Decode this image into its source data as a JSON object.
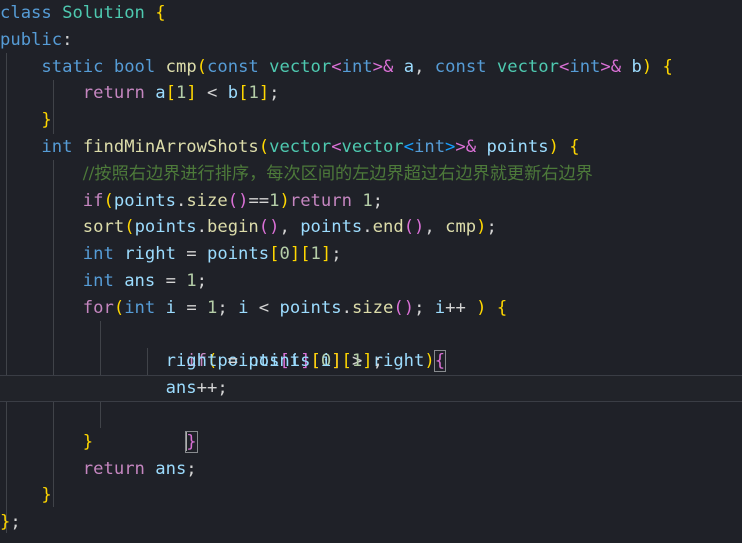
{
  "editor": {
    "language": "cpp",
    "theme": "dark-plus",
    "background": "#1f2128",
    "font_size_px": 17.2,
    "line_height_px": 26.8,
    "tab_size": 4,
    "current_line_number": 14,
    "cursor_line": 15,
    "colors": {
      "keyword": "#569cd6",
      "control": "#c586c0",
      "type": "#4ec9b0",
      "function": "#dcdcaa",
      "variable": "#9cdcfe",
      "number": "#b5cea8",
      "comment": "#4d7a3a",
      "operator": "#d4d4d4",
      "bracket_level_1": "#ffd700",
      "bracket_level_2": "#da70d6",
      "bracket_level_3": "#179fff",
      "indent_guide": "#404349",
      "current_line_border": "#3a3d45",
      "bracket_match_outline": "#888b8f",
      "cursor": "#aeafad"
    }
  },
  "code": {
    "lines": [
      "class Solution {",
      "public:",
      "    static bool cmp(const vector<int>& a, const vector<int>& b) {",
      "        return a[1] < b[1];",
      "    }",
      "    int findMinArrowShots(vector<vector<int>>& points) {",
      "        //按照右边界进行排序，每次区间的左边界超过右边界就更新右边界",
      "        if(points.size()==1)return 1;",
      "        sort(points.begin(), points.end(), cmp);",
      "        int right = points[0][1];",
      "        int ans = 1;",
      "        for(int i = 1; i < points.size(); i++ ) {",
      "            if(points[i][0] > right){",
      "                right = points[i][1];",
      "                ans++;",
      "            }",
      "        }",
      "        return ans;",
      "    }",
      "};"
    ],
    "comment_text": "//按照右边界进行排序，每次区间的左边界超过右边界就更新右边界",
    "class_name": "Solution",
    "methods": [
      "cmp",
      "findMinArrowShots"
    ],
    "variables": [
      "a",
      "b",
      "points",
      "right",
      "ans",
      "i"
    ],
    "literals": [
      "1",
      "0"
    ]
  },
  "tokens": {
    "l1": [
      {
        "t": "class",
        "c": "kw"
      },
      {
        "t": " ",
        "c": "op"
      },
      {
        "t": "Solution",
        "c": "type"
      },
      {
        "t": " ",
        "c": "op"
      },
      {
        "t": "{",
        "c": "b1"
      }
    ],
    "l2": [
      {
        "t": "public",
        "c": "kw"
      },
      {
        "t": ":",
        "c": "op"
      }
    ],
    "l3": [
      {
        "t": "    ",
        "c": "op"
      },
      {
        "t": "static",
        "c": "kw"
      },
      {
        "t": " ",
        "c": "op"
      },
      {
        "t": "bool",
        "c": "kw"
      },
      {
        "t": " ",
        "c": "op"
      },
      {
        "t": "cmp",
        "c": "fn"
      },
      {
        "t": "(",
        "c": "b1"
      },
      {
        "t": "const",
        "c": "kw"
      },
      {
        "t": " ",
        "c": "op"
      },
      {
        "t": "vector",
        "c": "type"
      },
      {
        "t": "<",
        "c": "b2"
      },
      {
        "t": "int",
        "c": "kw"
      },
      {
        "t": ">",
        "c": "b2"
      },
      {
        "t": "&",
        "c": "b2"
      },
      {
        "t": " ",
        "c": "op"
      },
      {
        "t": "a",
        "c": "var"
      },
      {
        "t": ", ",
        "c": "op"
      },
      {
        "t": "const",
        "c": "kw"
      },
      {
        "t": " ",
        "c": "op"
      },
      {
        "t": "vector",
        "c": "type"
      },
      {
        "t": "<",
        "c": "b2"
      },
      {
        "t": "int",
        "c": "kw"
      },
      {
        "t": ">",
        "c": "b2"
      },
      {
        "t": "&",
        "c": "b2"
      },
      {
        "t": " ",
        "c": "op"
      },
      {
        "t": "b",
        "c": "var"
      },
      {
        "t": ")",
        "c": "b1"
      },
      {
        "t": " ",
        "c": "op"
      },
      {
        "t": "{",
        "c": "b1"
      }
    ],
    "l4": [
      {
        "t": "        ",
        "c": "op"
      },
      {
        "t": "return",
        "c": "ctrl"
      },
      {
        "t": " ",
        "c": "op"
      },
      {
        "t": "a",
        "c": "var"
      },
      {
        "t": "[",
        "c": "b1"
      },
      {
        "t": "1",
        "c": "num"
      },
      {
        "t": "]",
        "c": "b1"
      },
      {
        "t": " < ",
        "c": "op"
      },
      {
        "t": "b",
        "c": "var"
      },
      {
        "t": "[",
        "c": "b1"
      },
      {
        "t": "1",
        "c": "num"
      },
      {
        "t": "]",
        "c": "b1"
      },
      {
        "t": ";",
        "c": "op"
      }
    ],
    "l5": [
      {
        "t": "    ",
        "c": "op"
      },
      {
        "t": "}",
        "c": "b1"
      }
    ],
    "l6": [
      {
        "t": "    ",
        "c": "op"
      },
      {
        "t": "int",
        "c": "kw"
      },
      {
        "t": " ",
        "c": "op"
      },
      {
        "t": "findMinArrowShots",
        "c": "fn"
      },
      {
        "t": "(",
        "c": "b1"
      },
      {
        "t": "vector",
        "c": "type"
      },
      {
        "t": "<",
        "c": "b2"
      },
      {
        "t": "vector",
        "c": "type"
      },
      {
        "t": "<",
        "c": "b3"
      },
      {
        "t": "int",
        "c": "kw"
      },
      {
        "t": ">",
        "c": "b3"
      },
      {
        "t": ">",
        "c": "b2"
      },
      {
        "t": "&",
        "c": "b2"
      },
      {
        "t": " ",
        "c": "op"
      },
      {
        "t": "points",
        "c": "var"
      },
      {
        "t": ")",
        "c": "b1"
      },
      {
        "t": " ",
        "c": "op"
      },
      {
        "t": "{",
        "c": "b1"
      }
    ],
    "l7": [
      {
        "t": "        ",
        "c": "op"
      },
      {
        "t": "//按照右边界进行排序，每次区间的左边界超过右边界就更新右边界",
        "c": "cmt"
      }
    ],
    "l8": [
      {
        "t": "        ",
        "c": "op"
      },
      {
        "t": "if",
        "c": "ctrl"
      },
      {
        "t": "(",
        "c": "b1"
      },
      {
        "t": "points",
        "c": "var"
      },
      {
        "t": ".",
        "c": "op"
      },
      {
        "t": "size",
        "c": "fn"
      },
      {
        "t": "(",
        "c": "b2"
      },
      {
        "t": ")",
        "c": "b2"
      },
      {
        "t": "==",
        "c": "op"
      },
      {
        "t": "1",
        "c": "num"
      },
      {
        "t": ")",
        "c": "b1"
      },
      {
        "t": "return",
        "c": "ctrl"
      },
      {
        "t": " ",
        "c": "op"
      },
      {
        "t": "1",
        "c": "num"
      },
      {
        "t": ";",
        "c": "op"
      }
    ],
    "l9": [
      {
        "t": "        ",
        "c": "op"
      },
      {
        "t": "sort",
        "c": "fn"
      },
      {
        "t": "(",
        "c": "b1"
      },
      {
        "t": "points",
        "c": "var"
      },
      {
        "t": ".",
        "c": "op"
      },
      {
        "t": "begin",
        "c": "fn"
      },
      {
        "t": "(",
        "c": "b2"
      },
      {
        "t": ")",
        "c": "b2"
      },
      {
        "t": ", ",
        "c": "op"
      },
      {
        "t": "points",
        "c": "var"
      },
      {
        "t": ".",
        "c": "op"
      },
      {
        "t": "end",
        "c": "fn"
      },
      {
        "t": "(",
        "c": "b2"
      },
      {
        "t": ")",
        "c": "b2"
      },
      {
        "t": ", ",
        "c": "op"
      },
      {
        "t": "cmp",
        "c": "fn"
      },
      {
        "t": ")",
        "c": "b1"
      },
      {
        "t": ";",
        "c": "op"
      }
    ],
    "l10": [
      {
        "t": "        ",
        "c": "op"
      },
      {
        "t": "int",
        "c": "kw"
      },
      {
        "t": " ",
        "c": "op"
      },
      {
        "t": "right",
        "c": "var"
      },
      {
        "t": " = ",
        "c": "op"
      },
      {
        "t": "points",
        "c": "var"
      },
      {
        "t": "[",
        "c": "b1"
      },
      {
        "t": "0",
        "c": "num"
      },
      {
        "t": "]",
        "c": "b1"
      },
      {
        "t": "[",
        "c": "b1"
      },
      {
        "t": "1",
        "c": "num"
      },
      {
        "t": "]",
        "c": "b1"
      },
      {
        "t": ";",
        "c": "op"
      }
    ],
    "l11": [
      {
        "t": "        ",
        "c": "op"
      },
      {
        "t": "int",
        "c": "kw"
      },
      {
        "t": " ",
        "c": "op"
      },
      {
        "t": "ans",
        "c": "var"
      },
      {
        "t": " = ",
        "c": "op"
      },
      {
        "t": "1",
        "c": "num"
      },
      {
        "t": ";",
        "c": "op"
      }
    ],
    "l12": [
      {
        "t": "        ",
        "c": "op"
      },
      {
        "t": "for",
        "c": "ctrl"
      },
      {
        "t": "(",
        "c": "b1"
      },
      {
        "t": "int",
        "c": "kw"
      },
      {
        "t": " ",
        "c": "op"
      },
      {
        "t": "i",
        "c": "var"
      },
      {
        "t": " = ",
        "c": "op"
      },
      {
        "t": "1",
        "c": "num"
      },
      {
        "t": "; ",
        "c": "op"
      },
      {
        "t": "i",
        "c": "var"
      },
      {
        "t": " < ",
        "c": "op"
      },
      {
        "t": "points",
        "c": "var"
      },
      {
        "t": ".",
        "c": "op"
      },
      {
        "t": "size",
        "c": "fn"
      },
      {
        "t": "(",
        "c": "b2"
      },
      {
        "t": ")",
        "c": "b2"
      },
      {
        "t": "; ",
        "c": "op"
      },
      {
        "t": "i",
        "c": "var"
      },
      {
        "t": "++ ",
        "c": "op"
      },
      {
        "t": ")",
        "c": "b1"
      },
      {
        "t": " ",
        "c": "op"
      },
      {
        "t": "{",
        "c": "b1"
      }
    ],
    "l13": [
      {
        "t": "            ",
        "c": "op"
      },
      {
        "t": "if",
        "c": "ctrl"
      },
      {
        "t": "(",
        "c": "b1"
      },
      {
        "t": "points",
        "c": "var"
      },
      {
        "t": "[",
        "c": "b2"
      },
      {
        "t": "i",
        "c": "var"
      },
      {
        "t": "]",
        "c": "b2"
      },
      {
        "t": "[",
        "c": "b2"
      },
      {
        "t": "0",
        "c": "num"
      },
      {
        "t": "]",
        "c": "b2"
      },
      {
        "t": " > ",
        "c": "op"
      },
      {
        "t": "right",
        "c": "var"
      },
      {
        "t": ")",
        "c": "b1"
      }
    ],
    "l13b": "{",
    "l14": [
      {
        "t": "                ",
        "c": "op"
      },
      {
        "t": "right",
        "c": "var"
      },
      {
        "t": " = ",
        "c": "op"
      },
      {
        "t": "points",
        "c": "var"
      },
      {
        "t": "[",
        "c": "b1"
      },
      {
        "t": "i",
        "c": "var"
      },
      {
        "t": "]",
        "c": "b1"
      },
      {
        "t": "[",
        "c": "b1"
      },
      {
        "t": "1",
        "c": "num"
      },
      {
        "t": "]",
        "c": "b1"
      },
      {
        "t": ";",
        "c": "op"
      }
    ],
    "l15": [
      {
        "t": "                ",
        "c": "op"
      },
      {
        "t": "ans",
        "c": "var"
      },
      {
        "t": "++;",
        "c": "op"
      }
    ],
    "l16a": "            ",
    "l16b": "}",
    "l17": [
      {
        "t": "        ",
        "c": "op"
      },
      {
        "t": "}",
        "c": "b1"
      }
    ],
    "l18": [
      {
        "t": "        ",
        "c": "op"
      },
      {
        "t": "return",
        "c": "ctrl"
      },
      {
        "t": " ",
        "c": "op"
      },
      {
        "t": "ans",
        "c": "var"
      },
      {
        "t": ";",
        "c": "op"
      }
    ],
    "l19": [
      {
        "t": "    ",
        "c": "op"
      },
      {
        "t": "}",
        "c": "b1"
      }
    ],
    "l20": [
      {
        "t": "}",
        "c": "b1"
      },
      {
        "t": ";",
        "c": "op"
      }
    ]
  }
}
